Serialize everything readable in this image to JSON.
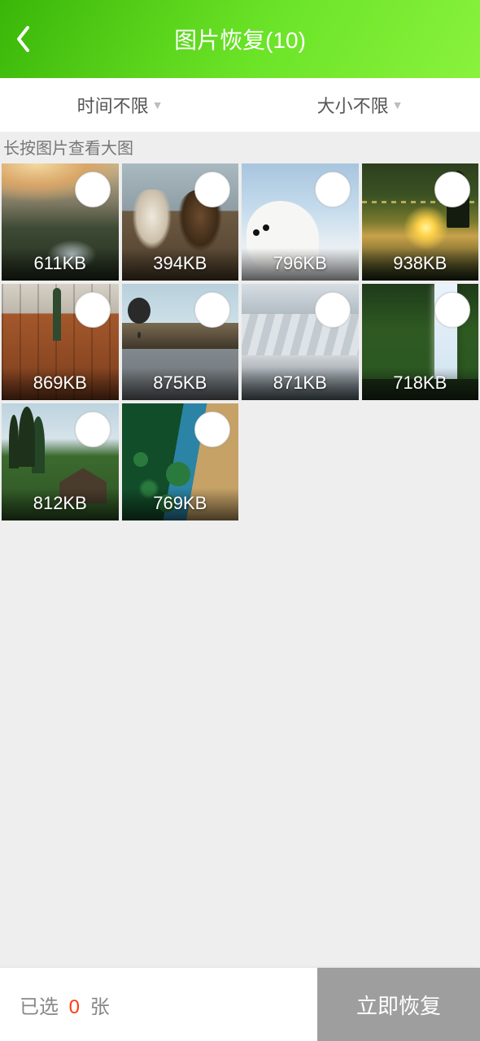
{
  "header": {
    "title": "图片恢复(10)"
  },
  "filters": {
    "time": "时间不限",
    "size": "大小不限"
  },
  "hint": "长按图片查看大图",
  "images": [
    {
      "size": "611KB",
      "scene": "scene-mountain-valley",
      "name": "mountain-valley"
    },
    {
      "size": "394KB",
      "scene": "scene-horses",
      "name": "horses"
    },
    {
      "size": "796KB",
      "scene": "scene-arctic-fox",
      "name": "arctic-fox"
    },
    {
      "size": "938KB",
      "scene": "scene-sunset-tree",
      "name": "sunset-tree"
    },
    {
      "size": "869KB",
      "scene": "scene-brick-city",
      "name": "brick-city"
    },
    {
      "size": "875KB",
      "scene": "scene-city-road",
      "name": "city-road"
    },
    {
      "size": "871KB",
      "scene": "scene-glacier",
      "name": "glacier"
    },
    {
      "size": "718KB",
      "scene": "scene-waterfall",
      "name": "waterfall"
    },
    {
      "size": "812KB",
      "scene": "scene-barn-field",
      "name": "barn-field"
    },
    {
      "size": "769KB",
      "scene": "scene-aerial",
      "name": "aerial"
    }
  ],
  "footer": {
    "selected_prefix": "已选",
    "selected_count": "0",
    "selected_suffix": "张",
    "recover_label": "立即恢复"
  }
}
